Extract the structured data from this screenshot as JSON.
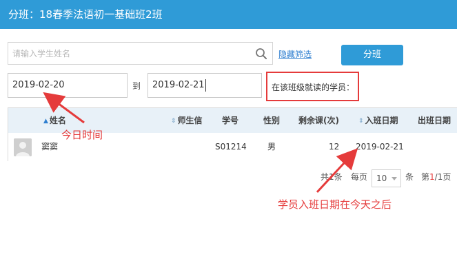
{
  "window": {
    "title": "分班：18春季法语初一基础班2班"
  },
  "search": {
    "placeholder": "请输入学生姓名",
    "value": ""
  },
  "filter": {
    "hide_label": "隐藏筛选"
  },
  "toolbar": {
    "assign_label": "分班"
  },
  "dates": {
    "from": "2019-02-20",
    "to_label": "到",
    "to": "2019-02-21"
  },
  "enrolled_label": "在该班级就读的学员：",
  "table": {
    "headers": [
      "姓名",
      "师生信",
      "学号",
      "性别",
      "剩余课(次)",
      "入班日期",
      "出班日期"
    ],
    "rows": [
      {
        "name": "窦窦",
        "teacher_letter": "",
        "student_id": "S01214",
        "gender": "男",
        "remaining": "12",
        "enter_date": "2019-02-21",
        "exit_date": ""
      }
    ]
  },
  "pagination": {
    "total_prefix": "共",
    "total": "1",
    "total_suffix": "条",
    "per_page_label": "每页",
    "per_page": "10",
    "per_page_suffix": "条",
    "page_prefix": "第",
    "current": "1",
    "page_sep": "/",
    "pages": "1",
    "page_suffix": "页"
  },
  "annotations": {
    "today": "今日时间",
    "enter_after": "学员入班日期在今天之后"
  },
  "colors": {
    "header": "#2f9bd7",
    "accent_red": "#e53b3b",
    "table_head": "#e8f1f8"
  }
}
